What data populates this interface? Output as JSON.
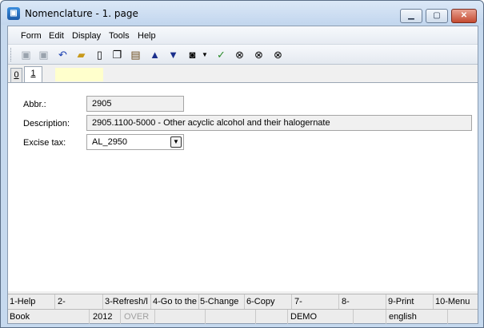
{
  "window": {
    "title": "Nomenclature - 1. page"
  },
  "menu": [
    "Form",
    "Edit",
    "Display",
    "Tools",
    "Help"
  ],
  "toolbar_icons": [
    "save-icon",
    "save-as-icon",
    "undo-icon",
    "open-folder-icon",
    "new-document-icon",
    "copy-icon",
    "book-icon",
    "arrow-up-icon",
    "arrow-down-icon",
    "camera-icon",
    "dropdown-arrow-icon",
    "filter-icon",
    "find-icon",
    "find-next-icon",
    "find-all-icon"
  ],
  "tabs": [
    "0",
    "1"
  ],
  "form": {
    "abbr_label": "Abbr.:",
    "abbr_value": "2905",
    "description_label": "Description:",
    "description_value": "2905.1100-5000 - Other acyclic alcohol and their halogernate",
    "excise_label": "Excise tax:",
    "excise_value": "AL_2950"
  },
  "fkeys": [
    "1-Help",
    "2-",
    "3-Refresh/l",
    "4-Go to the",
    "5-Change",
    "6-Copy",
    "7-",
    "8-",
    "9-Print",
    "10-Menu"
  ],
  "status": {
    "module": "Book",
    "year": "2012",
    "mode": "OVER",
    "db": "DEMO",
    "language": "english"
  }
}
